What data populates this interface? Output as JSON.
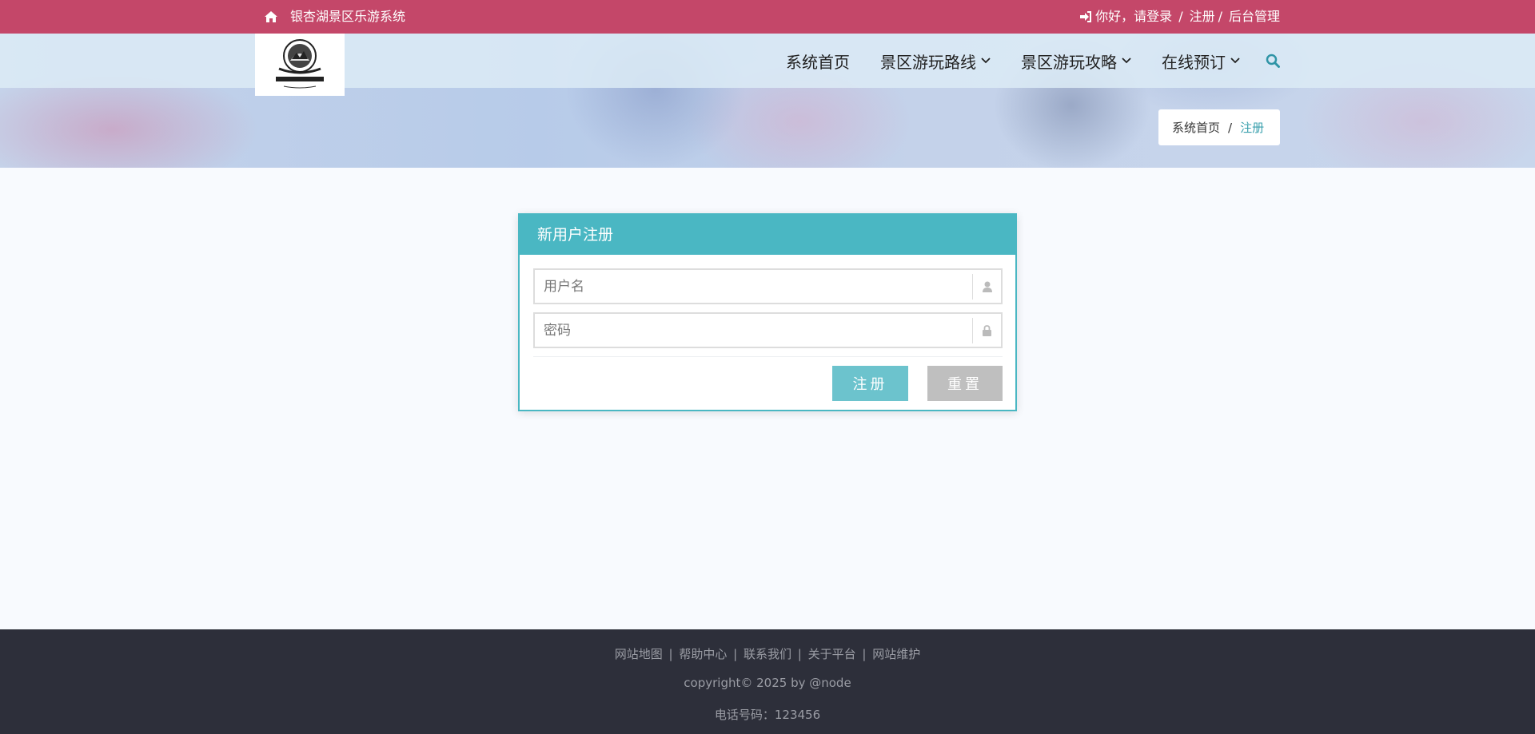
{
  "topbar": {
    "site_title": "银杏湖景区乐游系统",
    "greeting": "你好，请登录",
    "register_link": "注册",
    "admin_link": "后台管理",
    "separator": "/"
  },
  "nav": {
    "items": [
      {
        "label": "系统首页",
        "dropdown": false
      },
      {
        "label": "景区游玩路线",
        "dropdown": true
      },
      {
        "label": "景区游玩攻略",
        "dropdown": true
      },
      {
        "label": "在线预订",
        "dropdown": true
      }
    ]
  },
  "breadcrumb": {
    "home": "系统首页",
    "separator": "/",
    "current": "注册"
  },
  "register_panel": {
    "title": "新用户注册",
    "username_placeholder": "用户名",
    "password_placeholder": "密码",
    "register_button": "注册",
    "reset_button": "重置"
  },
  "footer": {
    "links": [
      "网站地图",
      "帮助中心",
      "联系我们",
      "关于平台",
      "网站维护"
    ],
    "link_separator": "|",
    "copyright": "copyright© 2025 by @node",
    "phone": "电话号码：123456"
  },
  "colors": {
    "topbar": "#c44769",
    "accent": "#4ab7c3",
    "register_button": "#6cc3cd",
    "reset_button": "#bfbfbf",
    "footer": "#2d2f3a",
    "search_icon": "#2f94a6"
  },
  "icons": {
    "home": "home-icon",
    "login": "sign-in-icon",
    "search": "search-icon",
    "user": "user-icon",
    "lock": "lock-icon",
    "dropdown": "chevron-down-icon"
  }
}
